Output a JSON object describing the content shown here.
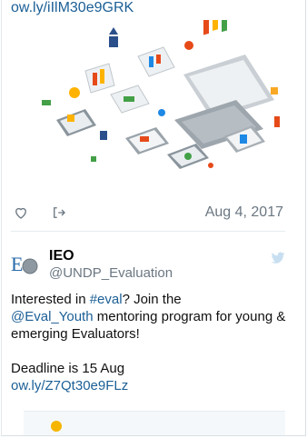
{
  "prev_tweet": {
    "link": "ow.ly/iIlM30e9GRK",
    "date": "Aug 4, 2017"
  },
  "tweet": {
    "author_name": "IEO",
    "author_handle": "@UNDP_Evaluation",
    "text": {
      "part1": "Interested in ",
      "hashtag": "#eval",
      "part2": "? Join the",
      "mention": "@Eval_Youth",
      "part3": " mentoring program for young & emerging Evaluators!",
      "deadline": "Deadline is 15 Aug",
      "link": "ow.ly/Z7Qt30e9FLz"
    }
  },
  "icons": {
    "like": "heart-icon",
    "share": "share-icon",
    "brand": "twitter-bird-icon",
    "avatar": "ieo-logo"
  },
  "colors": {
    "link": "#1b5f96",
    "muted": "#6b7782",
    "divider": "#e6ecf0",
    "bird": "#c7dff0"
  }
}
